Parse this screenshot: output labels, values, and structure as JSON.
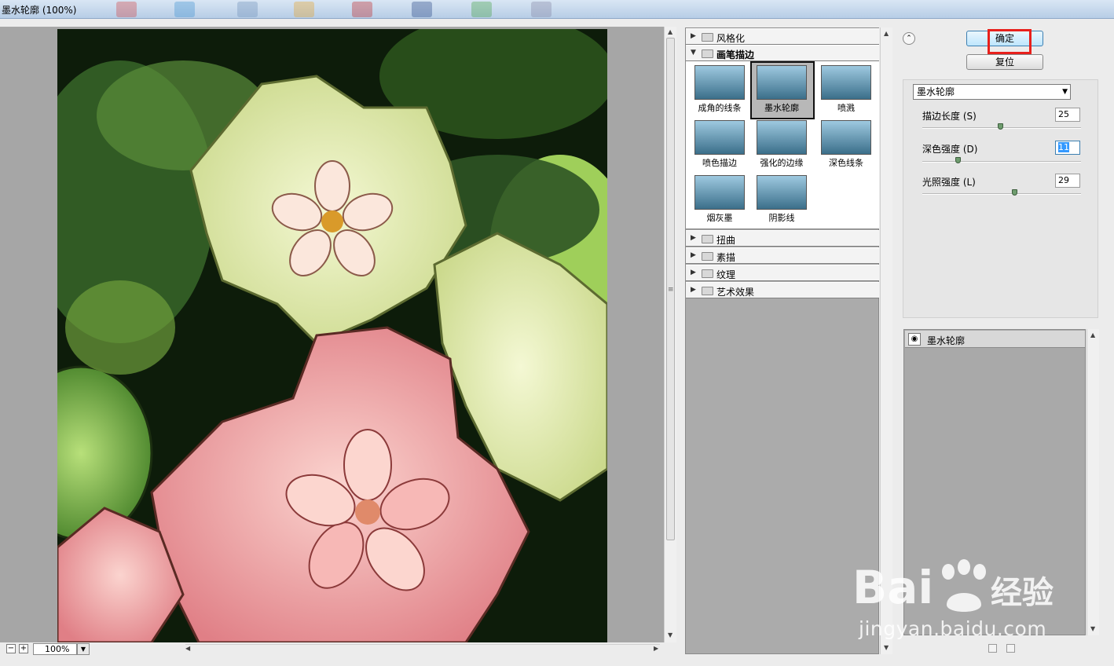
{
  "window": {
    "title": "墨水轮廓 (100%)"
  },
  "preview": {
    "zoom_value": "100%",
    "zoom_out_label": "−",
    "zoom_in_label": "+"
  },
  "gallery": {
    "categories": [
      {
        "label": "风格化",
        "expanded": false
      },
      {
        "label": "画笔描边",
        "expanded": true
      },
      {
        "label": "扭曲",
        "expanded": false
      },
      {
        "label": "素描",
        "expanded": false
      },
      {
        "label": "纹理",
        "expanded": false
      },
      {
        "label": "艺术效果",
        "expanded": false
      }
    ],
    "thumbnails": [
      {
        "label": "成角的线条"
      },
      {
        "label": "墨水轮廓",
        "selected": true
      },
      {
        "label": "喷溅"
      },
      {
        "label": "喷色描边"
      },
      {
        "label": "强化的边缘"
      },
      {
        "label": "深色线条"
      },
      {
        "label": "烟灰墨"
      },
      {
        "label": "阴影线"
      }
    ]
  },
  "buttons": {
    "ok_label": "确定",
    "reset_label": "复位"
  },
  "settings": {
    "filter_select": "墨水轮廓",
    "params": [
      {
        "label": "描边长度 (S)",
        "value": "25",
        "fraction": 0.49
      },
      {
        "label": "深色强度 (D)",
        "value": "11",
        "fraction": 0.22,
        "active": true
      },
      {
        "label": "光照强度 (L)",
        "value": "29",
        "fraction": 0.58
      }
    ]
  },
  "layers": {
    "items": [
      {
        "label": "墨水轮廓"
      }
    ]
  },
  "watermark": {
    "brand": "Bai",
    "brand_suffix": "经验",
    "url": "jingyan.baidu.com"
  },
  "colors": {
    "highlight": "#e8201c",
    "accent": "#3c7fb1"
  }
}
